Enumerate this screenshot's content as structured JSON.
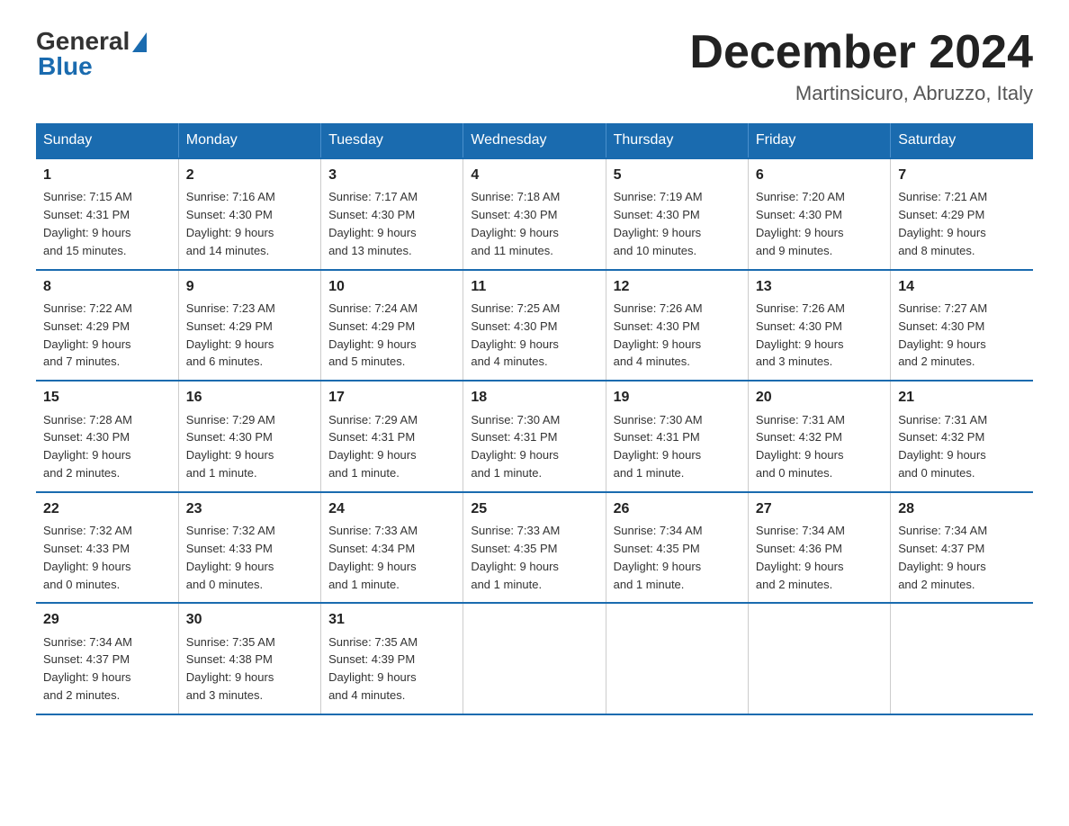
{
  "header": {
    "logo_general": "General",
    "logo_blue": "Blue",
    "month_title": "December 2024",
    "subtitle": "Martinsicuro, Abruzzo, Italy"
  },
  "days_of_week": [
    "Sunday",
    "Monday",
    "Tuesday",
    "Wednesday",
    "Thursday",
    "Friday",
    "Saturday"
  ],
  "weeks": [
    [
      {
        "day": "1",
        "sunrise": "7:15 AM",
        "sunset": "4:31 PM",
        "daylight": "9 hours and 15 minutes."
      },
      {
        "day": "2",
        "sunrise": "7:16 AM",
        "sunset": "4:30 PM",
        "daylight": "9 hours and 14 minutes."
      },
      {
        "day": "3",
        "sunrise": "7:17 AM",
        "sunset": "4:30 PM",
        "daylight": "9 hours and 13 minutes."
      },
      {
        "day": "4",
        "sunrise": "7:18 AM",
        "sunset": "4:30 PM",
        "daylight": "9 hours and 11 minutes."
      },
      {
        "day": "5",
        "sunrise": "7:19 AM",
        "sunset": "4:30 PM",
        "daylight": "9 hours and 10 minutes."
      },
      {
        "day": "6",
        "sunrise": "7:20 AM",
        "sunset": "4:30 PM",
        "daylight": "9 hours and 9 minutes."
      },
      {
        "day": "7",
        "sunrise": "7:21 AM",
        "sunset": "4:29 PM",
        "daylight": "9 hours and 8 minutes."
      }
    ],
    [
      {
        "day": "8",
        "sunrise": "7:22 AM",
        "sunset": "4:29 PM",
        "daylight": "9 hours and 7 minutes."
      },
      {
        "day": "9",
        "sunrise": "7:23 AM",
        "sunset": "4:29 PM",
        "daylight": "9 hours and 6 minutes."
      },
      {
        "day": "10",
        "sunrise": "7:24 AM",
        "sunset": "4:29 PM",
        "daylight": "9 hours and 5 minutes."
      },
      {
        "day": "11",
        "sunrise": "7:25 AM",
        "sunset": "4:30 PM",
        "daylight": "9 hours and 4 minutes."
      },
      {
        "day": "12",
        "sunrise": "7:26 AM",
        "sunset": "4:30 PM",
        "daylight": "9 hours and 4 minutes."
      },
      {
        "day": "13",
        "sunrise": "7:26 AM",
        "sunset": "4:30 PM",
        "daylight": "9 hours and 3 minutes."
      },
      {
        "day": "14",
        "sunrise": "7:27 AM",
        "sunset": "4:30 PM",
        "daylight": "9 hours and 2 minutes."
      }
    ],
    [
      {
        "day": "15",
        "sunrise": "7:28 AM",
        "sunset": "4:30 PM",
        "daylight": "9 hours and 2 minutes."
      },
      {
        "day": "16",
        "sunrise": "7:29 AM",
        "sunset": "4:30 PM",
        "daylight": "9 hours and 1 minute."
      },
      {
        "day": "17",
        "sunrise": "7:29 AM",
        "sunset": "4:31 PM",
        "daylight": "9 hours and 1 minute."
      },
      {
        "day": "18",
        "sunrise": "7:30 AM",
        "sunset": "4:31 PM",
        "daylight": "9 hours and 1 minute."
      },
      {
        "day": "19",
        "sunrise": "7:30 AM",
        "sunset": "4:31 PM",
        "daylight": "9 hours and 1 minute."
      },
      {
        "day": "20",
        "sunrise": "7:31 AM",
        "sunset": "4:32 PM",
        "daylight": "9 hours and 0 minutes."
      },
      {
        "day": "21",
        "sunrise": "7:31 AM",
        "sunset": "4:32 PM",
        "daylight": "9 hours and 0 minutes."
      }
    ],
    [
      {
        "day": "22",
        "sunrise": "7:32 AM",
        "sunset": "4:33 PM",
        "daylight": "9 hours and 0 minutes."
      },
      {
        "day": "23",
        "sunrise": "7:32 AM",
        "sunset": "4:33 PM",
        "daylight": "9 hours and 0 minutes."
      },
      {
        "day": "24",
        "sunrise": "7:33 AM",
        "sunset": "4:34 PM",
        "daylight": "9 hours and 1 minute."
      },
      {
        "day": "25",
        "sunrise": "7:33 AM",
        "sunset": "4:35 PM",
        "daylight": "9 hours and 1 minute."
      },
      {
        "day": "26",
        "sunrise": "7:34 AM",
        "sunset": "4:35 PM",
        "daylight": "9 hours and 1 minute."
      },
      {
        "day": "27",
        "sunrise": "7:34 AM",
        "sunset": "4:36 PM",
        "daylight": "9 hours and 2 minutes."
      },
      {
        "day": "28",
        "sunrise": "7:34 AM",
        "sunset": "4:37 PM",
        "daylight": "9 hours and 2 minutes."
      }
    ],
    [
      {
        "day": "29",
        "sunrise": "7:34 AM",
        "sunset": "4:37 PM",
        "daylight": "9 hours and 2 minutes."
      },
      {
        "day": "30",
        "sunrise": "7:35 AM",
        "sunset": "4:38 PM",
        "daylight": "9 hours and 3 minutes."
      },
      {
        "day": "31",
        "sunrise": "7:35 AM",
        "sunset": "4:39 PM",
        "daylight": "9 hours and 4 minutes."
      },
      null,
      null,
      null,
      null
    ]
  ],
  "labels": {
    "sunrise": "Sunrise:",
    "sunset": "Sunset:",
    "daylight": "Daylight:"
  }
}
